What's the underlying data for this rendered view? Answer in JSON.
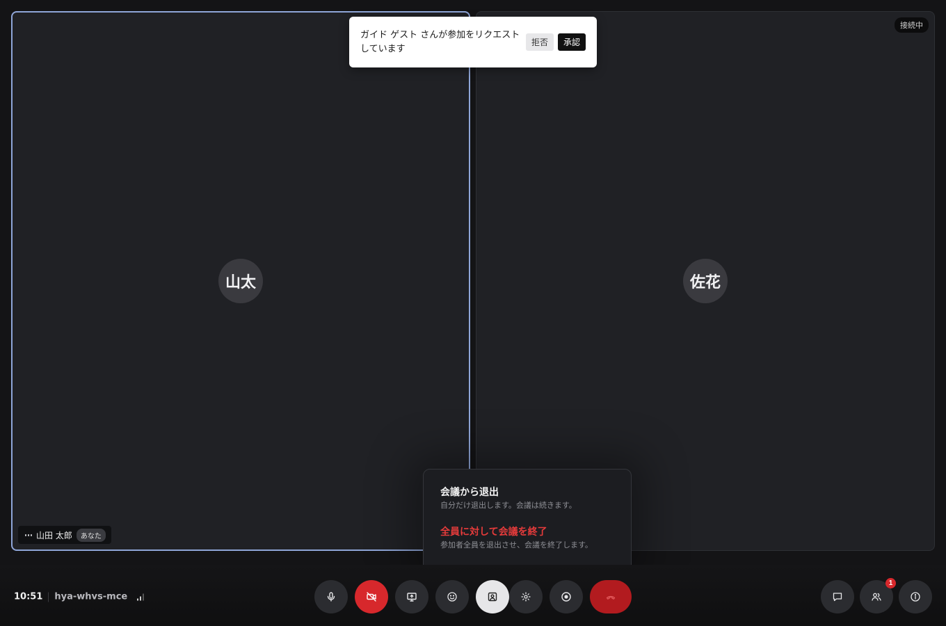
{
  "participants": [
    {
      "initials": "山太",
      "name": "山田 太郎",
      "you_label": "あなた"
    },
    {
      "initials": "佐花",
      "status": "接続中"
    }
  ],
  "join_request": {
    "message": "ガイド ゲスト さんが参加をリクエストしています",
    "deny_label": "拒否",
    "approve_label": "承認"
  },
  "leave_menu": {
    "leave": {
      "title": "会議から退出",
      "description": "自分だけ退出します。会議は続きます。"
    },
    "end_for_all": {
      "title": "全員に対して会議を終了",
      "description": "参加者全員を退出させ、会議を終了します。"
    }
  },
  "meeting": {
    "time": "10:51",
    "code": "hya-whvs-mce"
  },
  "controls": {
    "icons": [
      "mic-icon",
      "camera-off-icon",
      "present-screen-icon",
      "emoji-icon",
      "background-icon",
      "effects-icon",
      "record-icon",
      "hangup-icon"
    ],
    "side_icons": [
      "chat-icon",
      "people-icon",
      "info-icon"
    ],
    "people_badge": "1"
  },
  "colors": {
    "accent_border": "#8fa6d8",
    "danger": "#d7282c",
    "end_text": "#e53b3b",
    "tile_bg": "#202125"
  }
}
